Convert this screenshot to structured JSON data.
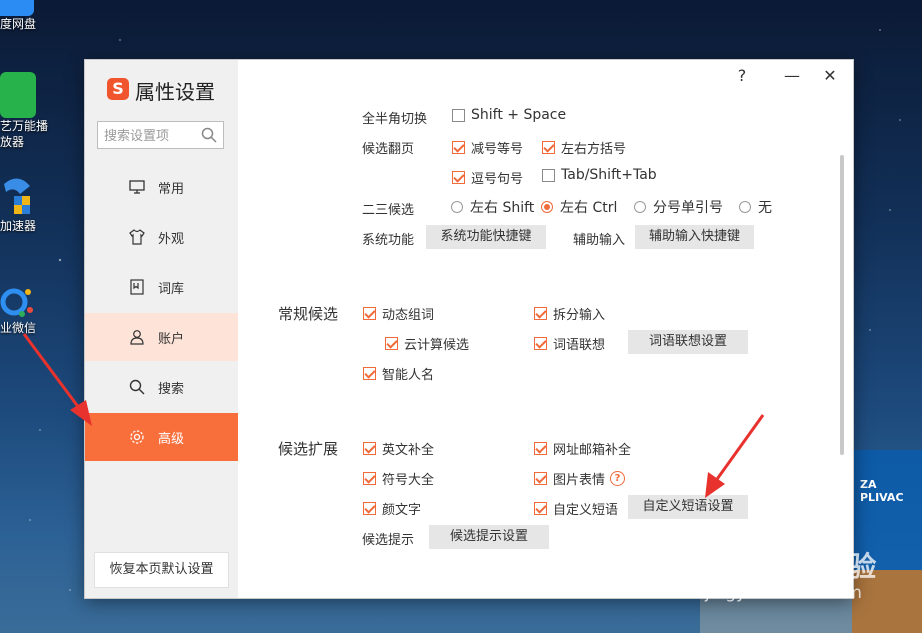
{
  "desktop": {
    "icons": [
      {
        "label": "度网盘"
      },
      {
        "label": "艺万能播"
      },
      {
        "label": "放器"
      },
      {
        "label": "加速器"
      },
      {
        "label": "业微信"
      }
    ],
    "billboard_text": "ZA PLIVAC"
  },
  "dialog": {
    "logo": "S",
    "title": "属性设置",
    "window_controls": {
      "help": "?",
      "minimize": "—",
      "close": "✕"
    },
    "search": {
      "placeholder": "搜索设置项"
    },
    "nav": [
      {
        "label": "常用",
        "icon": "monitor-icon"
      },
      {
        "label": "外观",
        "icon": "shirt-icon"
      },
      {
        "label": "词库",
        "icon": "dictionary-icon"
      },
      {
        "label": "账户",
        "icon": "user-icon"
      },
      {
        "label": "搜索",
        "icon": "search-icon"
      },
      {
        "label": "高级",
        "icon": "gear-icon",
        "active": true
      }
    ],
    "restore_button": "恢复本页默认设置",
    "settings": {
      "fullhalf": {
        "label": "全半角切换",
        "option": "Shift + Space"
      },
      "paging": {
        "label": "候选翻页",
        "opt1": "减号等号",
        "opt2": "左右方括号",
        "opt3": "逗号句号",
        "opt4": "Tab/Shift+Tab"
      },
      "second_third": {
        "label": "二三候选",
        "opt1": "左右 Shift",
        "opt2": "左右 Ctrl",
        "opt3": "分号单引号",
        "opt4": "无",
        "selected": "左右 Ctrl"
      },
      "sysfunc": {
        "label": "系统功能",
        "button": "系统功能快捷键"
      },
      "assist": {
        "label": "辅助输入",
        "button": "辅助输入快捷键"
      },
      "regular": {
        "label": "常规候选",
        "opt1": "动态组词",
        "opt2": "拆分输入",
        "opt3": "云计算候选",
        "opt4": "词语联想",
        "opt5": "智能人名",
        "button": "词语联想设置"
      },
      "extension": {
        "label": "候选扩展",
        "opt1": "英文补全",
        "opt2": "网址邮箱补全",
        "opt3": "符号大全",
        "opt4": "图片表情",
        "opt5": "颜文字",
        "opt6": "自定义短语",
        "button": "自定义短语设置",
        "help": "?"
      },
      "hint": {
        "label": "候选提示",
        "button": "候选提示设置"
      }
    }
  },
  "watermark": {
    "line1": "Bai du 经验",
    "line2": "jingyan.baidu.com"
  },
  "colors": {
    "accent": "#f86f3c",
    "checkbox": "#f06a3a",
    "arrow": "#e8322d"
  }
}
